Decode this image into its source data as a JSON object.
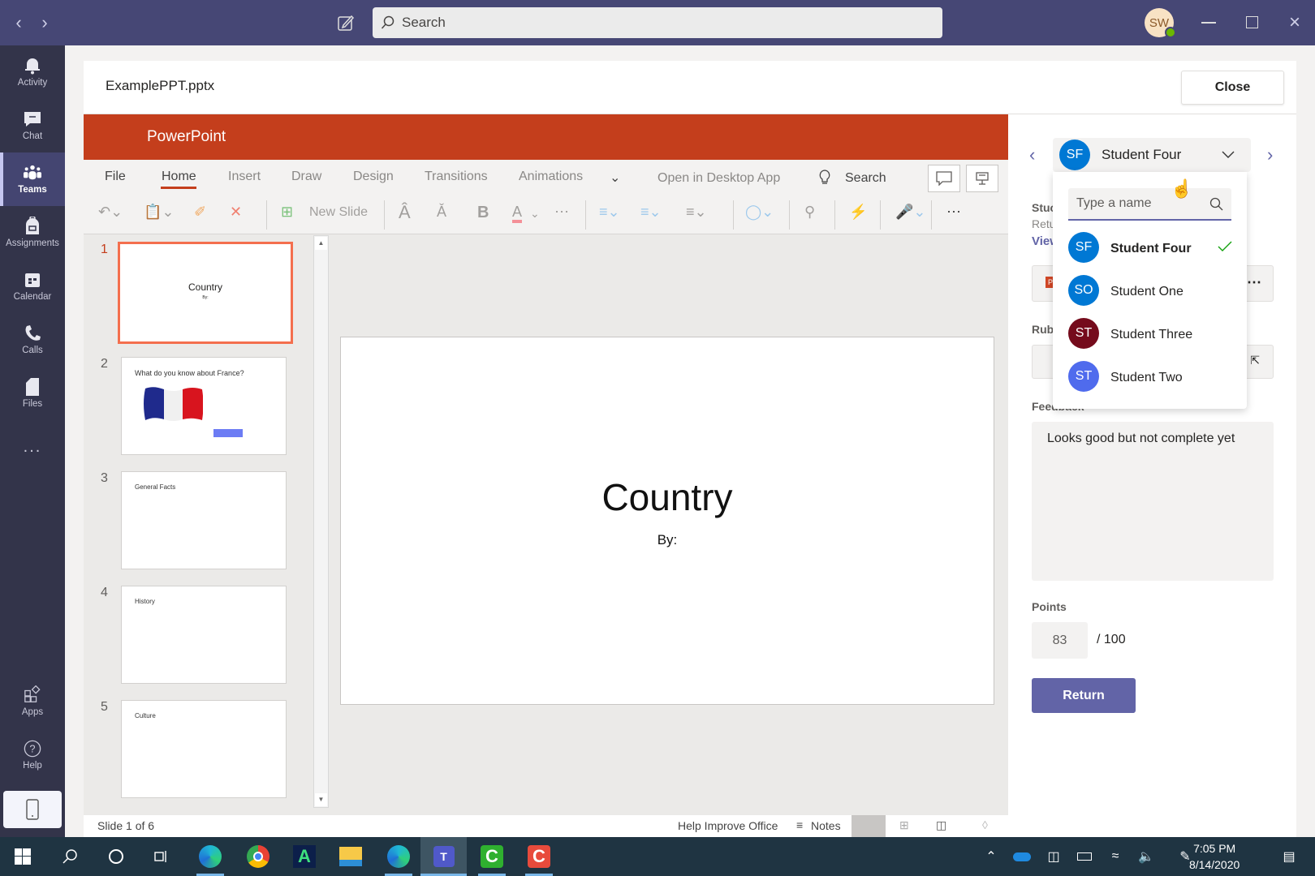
{
  "titlebar": {
    "back_icon": "chevron-left-icon",
    "forward_icon": "chevron-right-icon",
    "compose_icon": "compose-icon",
    "search_placeholder": "Search",
    "user_initials": "SW",
    "window_controls": [
      "minimize",
      "restore",
      "close"
    ]
  },
  "rail": {
    "items": [
      {
        "label": "Activity",
        "icon": "bell-icon"
      },
      {
        "label": "Chat",
        "icon": "chat-icon"
      },
      {
        "label": "Teams",
        "icon": "teams-icon",
        "active": true
      },
      {
        "label": "Assignments",
        "icon": "backpack-icon"
      },
      {
        "label": "Calendar",
        "icon": "calendar-icon"
      },
      {
        "label": "Calls",
        "icon": "phone-icon"
      },
      {
        "label": "Files",
        "icon": "file-icon"
      },
      {
        "label": "...",
        "icon": "more-icon"
      }
    ],
    "bottom": [
      {
        "label": "Apps",
        "icon": "apps-icon"
      },
      {
        "label": "Help",
        "icon": "help-icon"
      }
    ]
  },
  "header": {
    "filename": "ExamplePPT.pptx",
    "close_label": "Close"
  },
  "powerpoint": {
    "app_name": "PowerPoint",
    "tabs": [
      "File",
      "Home",
      "Insert",
      "Draw",
      "Design",
      "Transitions",
      "Animations"
    ],
    "selected_tab": "Home",
    "open_desktop": "Open in Desktop App",
    "search_label": "Search",
    "new_slide_label": "New Slide",
    "slides": [
      {
        "number": "1",
        "title": "Country",
        "subtitle": "By:"
      },
      {
        "number": "2",
        "title": "What do you know about France?"
      },
      {
        "number": "3",
        "title": "General Facts"
      },
      {
        "number": "4",
        "title": "History"
      },
      {
        "number": "5",
        "title": "Culture"
      }
    ],
    "current_slide": {
      "title": "Country",
      "subtitle": "By:"
    },
    "status": {
      "slide_counter": "Slide 1 of 6",
      "help_improve": "Help Improve Office",
      "notes": "Notes"
    }
  },
  "grading": {
    "selected_student": {
      "name": "Student Four",
      "initials": "SF",
      "color": "#0078d4"
    },
    "partial_labels": {
      "student": "Stuc",
      "returned": "Retu",
      "view": "View",
      "rubric": "Rub",
      "feedback": "Feedback"
    },
    "dropdown": {
      "search_placeholder": "Type a name",
      "students": [
        {
          "name": "Student Four",
          "initials": "SF",
          "color": "#0078d4",
          "selected": true
        },
        {
          "name": "Student One",
          "initials": "SO",
          "color": "#0078d4",
          "selected": false
        },
        {
          "name": "Student Three",
          "initials": "ST",
          "color": "#750b1c",
          "selected": false
        },
        {
          "name": "Student Two",
          "initials": "ST",
          "color": "#4f6bed",
          "selected": false
        }
      ]
    },
    "feedback_text": "Looks good but not complete yet",
    "points_label": "Points",
    "points_value": "83",
    "points_max": "/ 100",
    "return_label": "Return"
  },
  "taskbar": {
    "apps": [
      "start",
      "search",
      "cortana",
      "task-view",
      "edge",
      "chrome",
      "app-a",
      "file-explorer",
      "edge-dev",
      "teams",
      "camtasia-green",
      "camtasia-red"
    ],
    "time": "7:05 PM",
    "date": "8/14/2020"
  }
}
